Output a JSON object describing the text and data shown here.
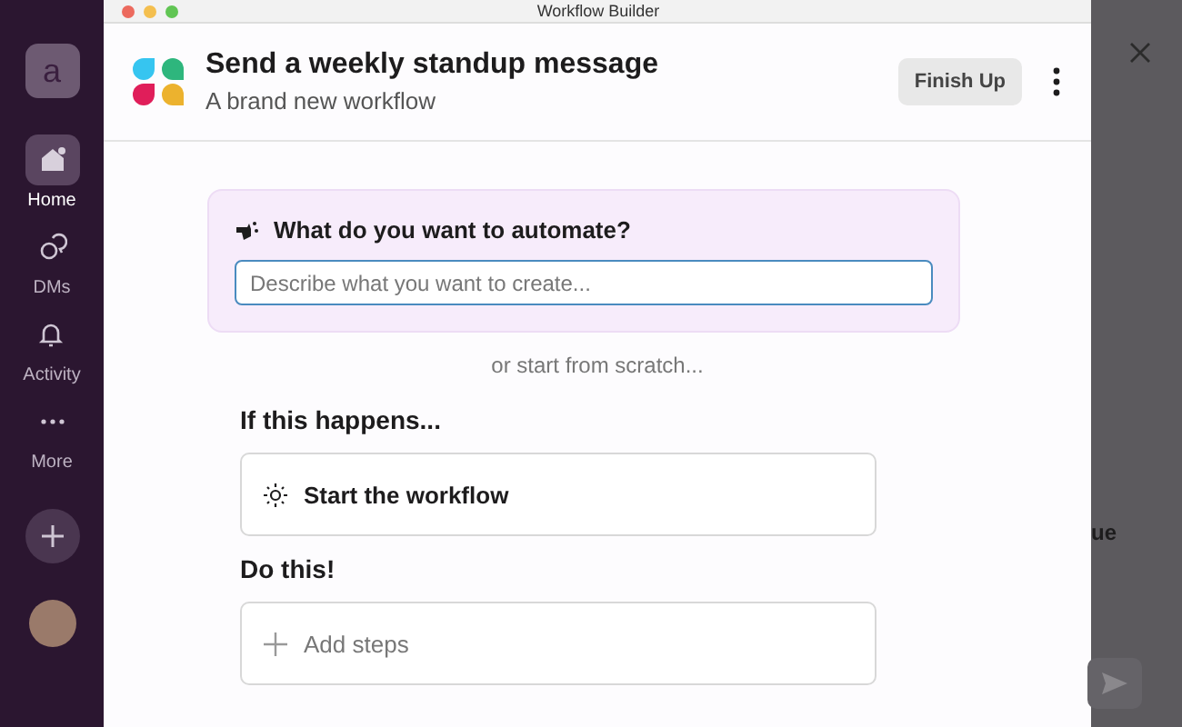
{
  "window": {
    "title": "Workflow Builder"
  },
  "sidebar": {
    "workspace": "a",
    "items": [
      {
        "label": "Home",
        "kind": "home",
        "selected": true
      },
      {
        "label": "DMs",
        "kind": "dms",
        "selected": false
      },
      {
        "label": "Activity",
        "kind": "activity",
        "selected": false
      },
      {
        "label": "More",
        "kind": "more",
        "selected": false
      }
    ]
  },
  "header": {
    "title": "Send a weekly standup message",
    "subtitle": "A brand new workflow",
    "button": "Finish Up"
  },
  "prompt": {
    "label": "What do you want to automate?",
    "placeholder": "Describe what you want to create..."
  },
  "scratch_text": "or start from scratch...",
  "sections": [
    {
      "heading": "If this happens...",
      "kind": "trigger",
      "label": "Start the workflow"
    },
    {
      "heading": "Do this!",
      "kind": "add",
      "label": "Add steps"
    }
  ],
  "background_panel": {
    "text": "ue"
  }
}
